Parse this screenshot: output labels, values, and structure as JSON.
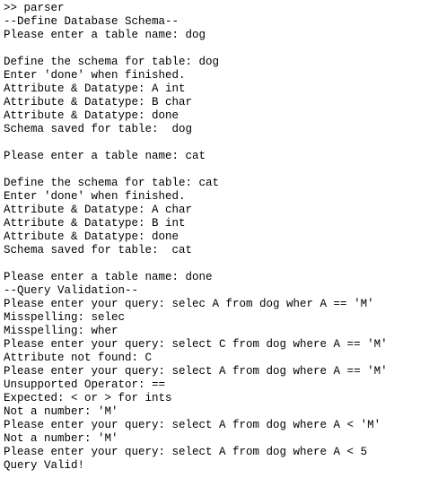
{
  "terminal": {
    "lines": [
      ">> parser",
      "--Define Database Schema--",
      "Please enter a table name: dog",
      "",
      "Define the schema for table: dog",
      "Enter 'done' when finished.",
      "Attribute & Datatype: A int",
      "Attribute & Datatype: B char",
      "Attribute & Datatype: done",
      "Schema saved for table:  dog",
      "",
      "Please enter a table name: cat",
      "",
      "Define the schema for table: cat",
      "Enter 'done' when finished.",
      "Attribute & Datatype: A char",
      "Attribute & Datatype: B int",
      "Attribute & Datatype: done",
      "Schema saved for table:  cat",
      "",
      "Please enter a table name: done",
      "--Query Validation--",
      "Please enter your query: selec A from dog wher A == 'M'",
      "Misspelling: selec",
      "Misspelling: wher",
      "Please enter your query: select C from dog where A == 'M'",
      "Attribute not found: C",
      "Please enter your query: select A from dog where A == 'M'",
      "Unsupported Operator: ==",
      "Expected: < or > for ints",
      "Not a number: 'M'",
      "Please enter your query: select A from dog where A < 'M'",
      "Not a number: 'M'",
      "Please enter your query: select A from dog where A < 5",
      "Query Valid!"
    ]
  }
}
